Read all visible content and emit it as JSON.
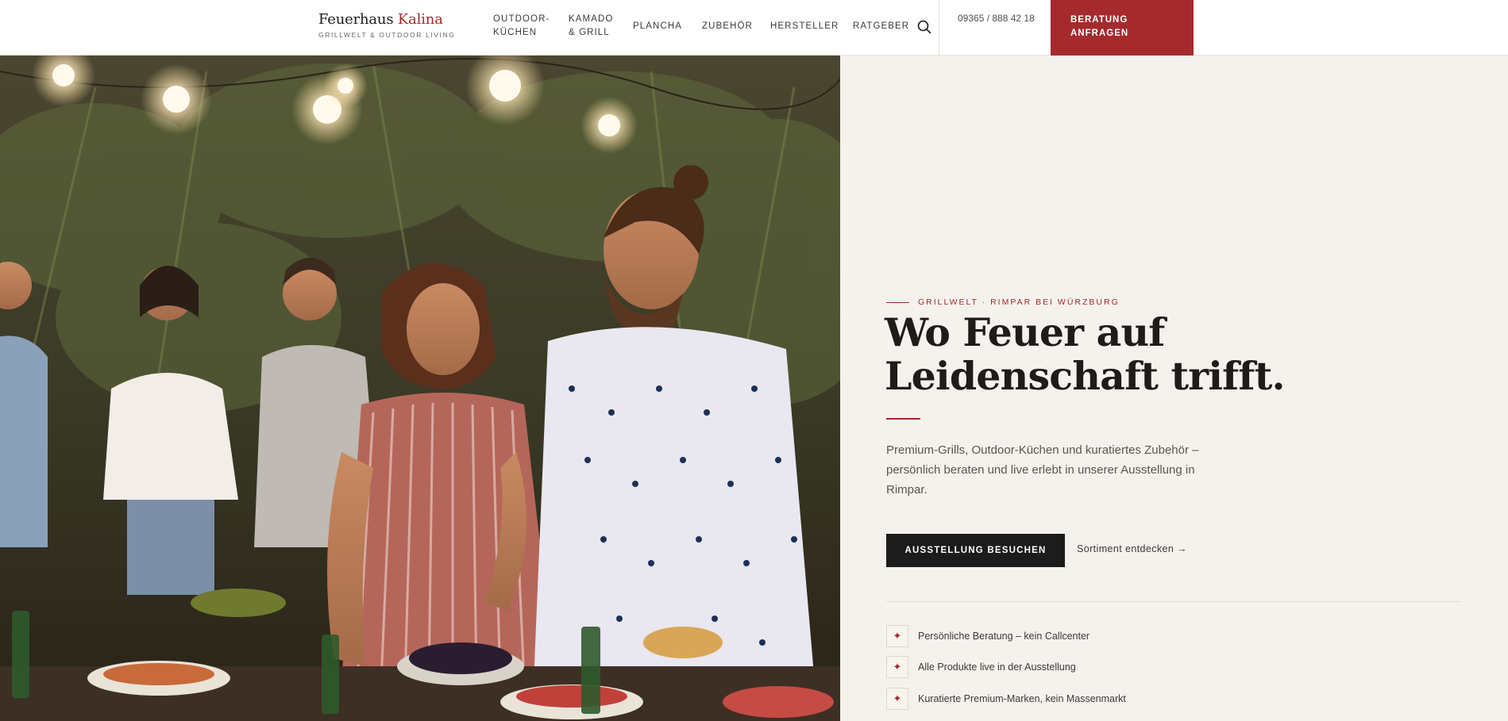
{
  "header": {
    "logo_name": "Feuerhaus",
    "logo_accent": "Kalina",
    "logo_tagline": "GRILLWELT & OUTDOOR LIVING",
    "nav": [
      {
        "line1": "OUTDOOR-",
        "line2": "KÜCHEN"
      },
      {
        "line1": "KAMADO",
        "line2": "& GRILL"
      },
      {
        "line1": "PLANCHA",
        "line2": ""
      },
      {
        "line1": "ZUBEHÖR",
        "line2": ""
      },
      {
        "line1": "HERSTELLER",
        "line2": ""
      },
      {
        "line1": "RATGEBER",
        "line2": ""
      }
    ],
    "search_icon": "search-icon",
    "phone": "09365 / 888 42 18",
    "cta": "BERATUNG ANFRAGEN"
  },
  "hero": {
    "image_alt": "Friends at an outdoor barbecue party under string lights",
    "eyebrow": "GRILLWELT · RIMPAR BEI WÜRZBURG",
    "headline_line1": "Wo Feuer auf",
    "headline_line2": "Leidenschaft trifft.",
    "lead": "Premium-Grills, Outdoor-Küchen und kuratiertes Zubehör – persönlich beraten und live erlebt in unserer Ausstellung in Rimpar.",
    "primary_button": "AUSSTELLUNG BESUCHEN",
    "secondary_link": "Sortiment entdecken →",
    "features": [
      {
        "icon": "sparkle-icon",
        "glyph": "✦",
        "text": "Persönliche Beratung – kein Callcenter"
      },
      {
        "icon": "sparkle-icon",
        "glyph": "✦",
        "text": "Alle Produkte live in der Ausstellung"
      },
      {
        "icon": "sparkle-icon",
        "glyph": "✦",
        "text": "Kuratierte Premium-Marken, kein Massenmarkt"
      }
    ]
  },
  "colors": {
    "accent": "#a52a2e",
    "background": "#f5f2ed",
    "dark": "#1c1c1c"
  }
}
